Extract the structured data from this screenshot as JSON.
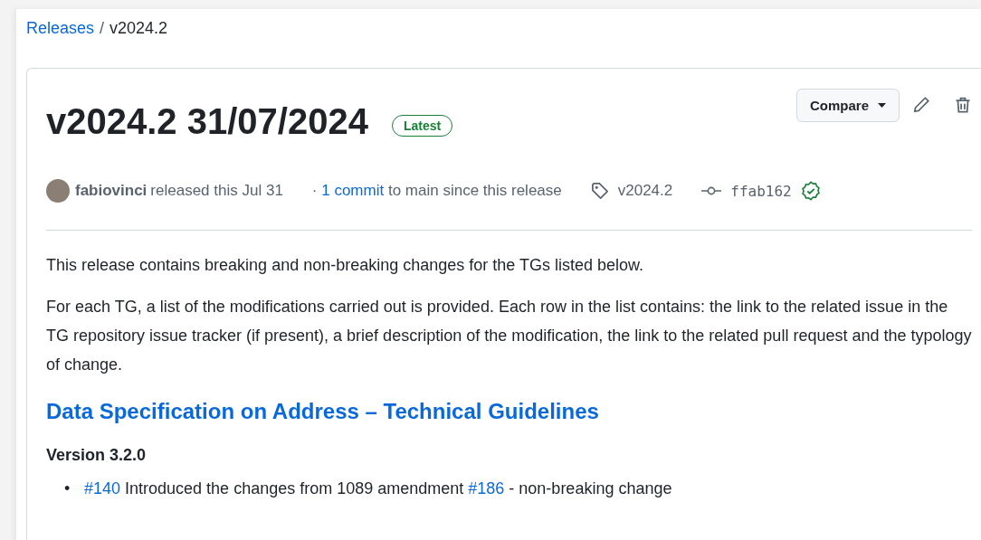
{
  "breadcrumb": {
    "parent": "Releases",
    "separator": "/",
    "current": "v2024.2"
  },
  "release": {
    "title": "v2024.2 31/07/2024",
    "badge": "Latest",
    "compare_button": "Compare",
    "meta": {
      "author": "fabiovinci",
      "released_text": "released this Jul 31",
      "commits_prefix": "·",
      "commits_link": "1 commit",
      "commits_suffix": "to main since this release",
      "tag": "v2024.2",
      "commit": "ffab162",
      "verified": true
    },
    "paragraphs": [
      "This release contains breaking and non-breaking changes for the TGs listed below.",
      "For each TG, a list of the modifications carried out is provided. Each row in the list contains: the link to the related issue in the TG repository issue tracker (if present), a brief description of the modification, the link to the related pull request and the typology of change."
    ],
    "sections": [
      {
        "heading": "Data Specification on Address – Technical Guidelines",
        "version": "Version 3.2.0",
        "items": [
          {
            "bullet": "•",
            "issue": "#140",
            "text": "Introduced the changes from 1089 amendment",
            "pr": "#186",
            "change": "- non-breaking change"
          }
        ]
      }
    ]
  }
}
